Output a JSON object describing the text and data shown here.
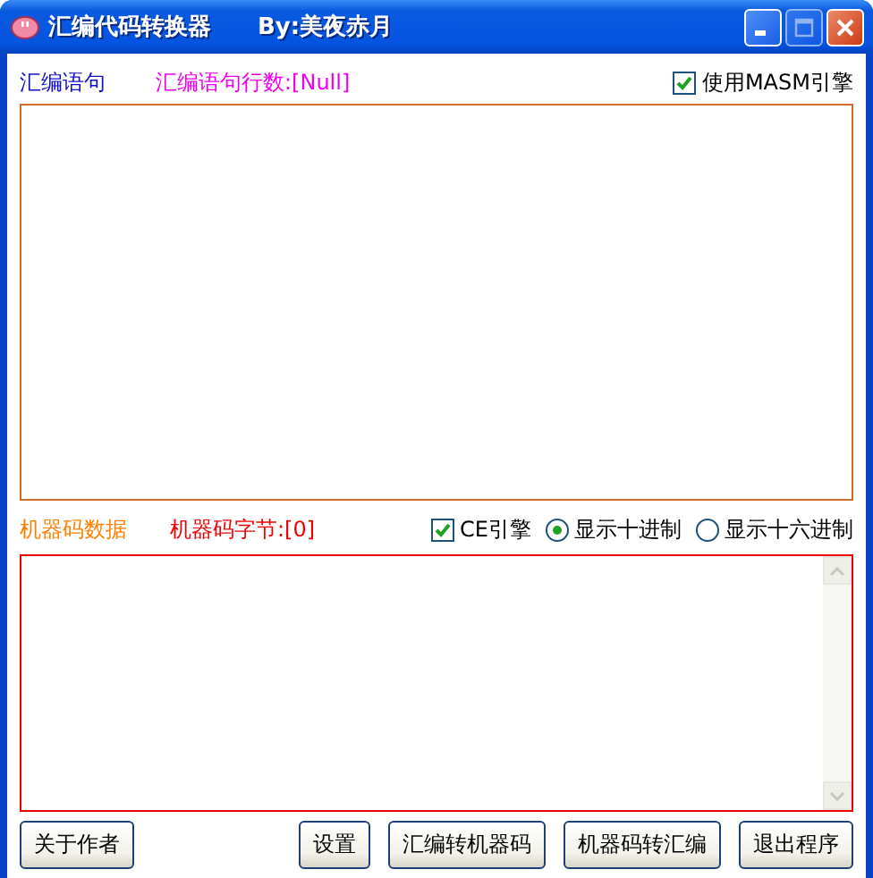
{
  "window": {
    "title": "汇编代码转换器",
    "author": "By:美夜赤月"
  },
  "assembly": {
    "label": "汇编语句",
    "line_count": "汇编语句行数:[Null]",
    "option": {
      "label": "使用MASM引擎",
      "checked": true
    }
  },
  "machine": {
    "label": "机器码数据",
    "byte_count": "机器码字节:[0]",
    "options": [
      {
        "kind": "checkbox",
        "label": "CE引擎",
        "checked": true
      },
      {
        "kind": "radio",
        "label": "显示十进制",
        "selected": true
      },
      {
        "kind": "radio",
        "label": "显示十六进制",
        "selected": false
      }
    ]
  },
  "buttons": [
    "关于作者",
    "设置",
    "汇编转机器码",
    "机器码转汇编",
    "退出程序"
  ]
}
